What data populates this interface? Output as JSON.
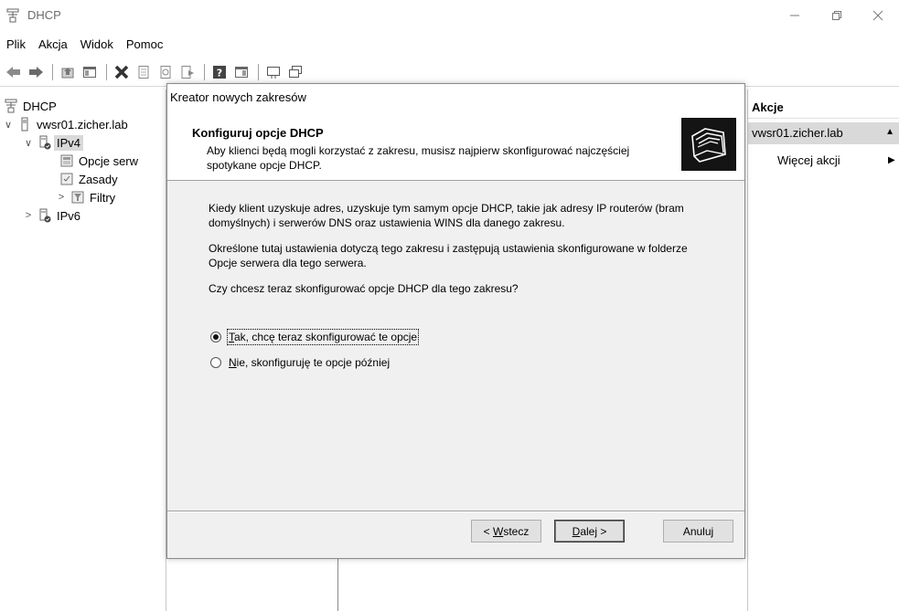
{
  "window": {
    "title": "DHCP"
  },
  "menu": [
    "Plik",
    "Akcja",
    "Widok",
    "Pomoc"
  ],
  "tree": {
    "root": "DHCP",
    "server": "vwsr01.zicher.lab",
    "ipv4": "IPv4",
    "server_options": "Opcje serw",
    "policies": "Zasady",
    "filters": "Filtry",
    "ipv6": "IPv6"
  },
  "actions": {
    "header": "Akcje",
    "group": "vwsr01.zicher.lab",
    "more": "Więcej akcji"
  },
  "dialog": {
    "title": "Kreator nowych zakresów",
    "heading": "Konfiguruj opcje DHCP",
    "heading_desc": "Aby klienci będą mogli korzystać z zakresu, musisz najpierw skonfigurować najczęściej spotykane opcje DHCP.",
    "para1": "Kiedy klient uzyskuje adres, uzyskuje tym samym opcje DHCP, takie jak adresy IP routerów (bram domyślnych) i serwerów DNS oraz ustawienia WINS dla danego zakresu.",
    "para2": "Określone tutaj ustawienia dotyczą tego zakresu i zastępują ustawienia skonfigurowane w folderze Opcje serwera dla tego serwera.",
    "question": "Czy chcesz teraz skonfigurować opcje DHCP dla tego zakresu?",
    "radio_yes": {
      "accel": "T",
      "rest": "ak, chcę teraz skonfigurować te opcje",
      "selected": true
    },
    "radio_no": {
      "accel": "N",
      "rest": "ie, skonfiguruję te opcje później",
      "selected": false
    },
    "btn_back": {
      "prefix": "< ",
      "accel": "W",
      "rest": "stecz"
    },
    "btn_next": {
      "accel": "D",
      "rest": "alej >"
    },
    "btn_cancel": "Anuluj"
  }
}
